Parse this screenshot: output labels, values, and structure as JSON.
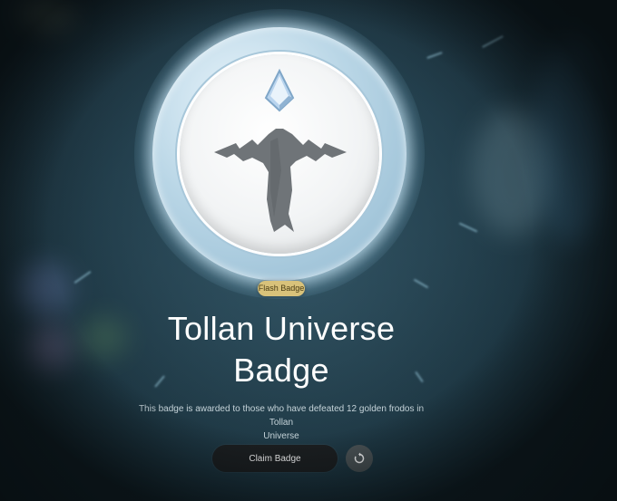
{
  "badge": {
    "tag_label": "Flash Badge",
    "title_line1": "Tollan Universe",
    "title_line2": "Badge",
    "description_line1": "This badge is awarded to those who have defeated 12 golden frodos in Tollan",
    "description_line2": "Universe",
    "emblem_icon": "winged-t-emblem-icon",
    "gem_icon": "crystal-gem-icon"
  },
  "actions": {
    "claim_label": "Claim Badge",
    "refresh_icon": "refresh-icon"
  },
  "colors": {
    "tag_background": "#d8c27a",
    "button_background": "#1c1f21",
    "refresh_background": "#4d5558",
    "emblem_color": "#6f7478"
  }
}
